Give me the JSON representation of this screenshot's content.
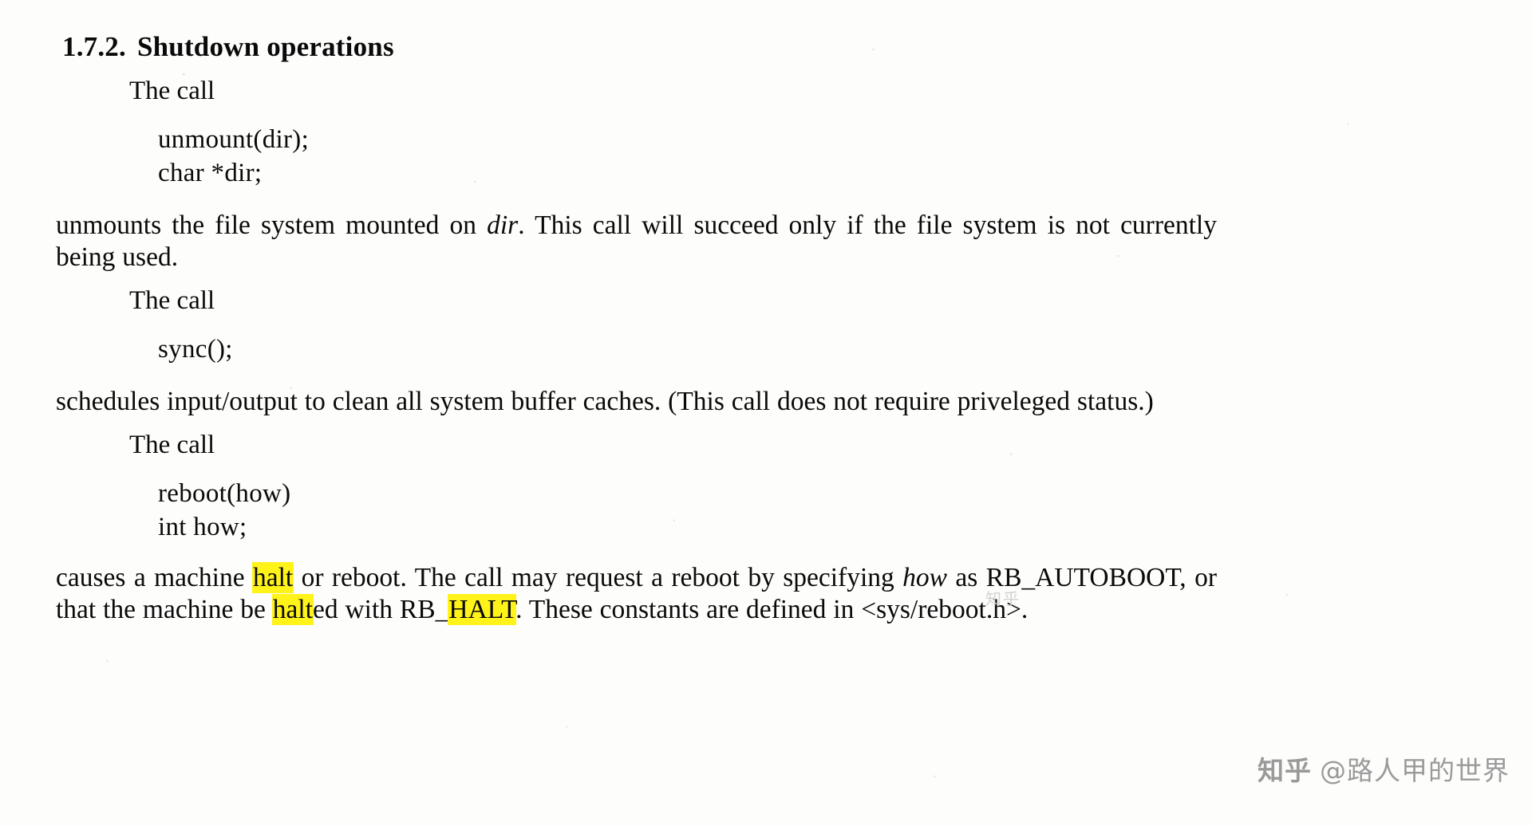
{
  "document": {
    "heading": {
      "number": "1.7.2.",
      "title": "Shutdown operations"
    },
    "blocks": {
      "lead_1": "The call",
      "code_1": "unmount(dir);\nchar *dir;",
      "para_1_a": "unmounts the file system mounted on ",
      "para_1_ital": "dir",
      "para_1_b": ".  This call will succeed only if the file system is not currently being used.",
      "lead_2": "The call",
      "code_2": "sync();",
      "para_2": "schedules input/output to clean all system buffer caches.  (This call does not require priveleged status.)",
      "lead_3": "The call",
      "code_3": "reboot(how)\nint how;",
      "para_3_a": "causes a machine ",
      "para_3_hl1": "halt",
      "para_3_b": " or reboot.  The call may request a reboot by specifying ",
      "para_3_ital": "how",
      "para_3_c": " as RB_AUTOBOOT, or that the machine be ",
      "para_3_hl2": "halt",
      "para_3_d": "ed with RB_",
      "para_3_hl3": "HALT",
      "para_3_e": ".  These constants are defined in <sys/reboot.h>."
    },
    "highlight_color": "#fff31a",
    "watermark": {
      "logo": "知乎",
      "handle": "@路人甲的世界",
      "faint": "知乎"
    }
  }
}
